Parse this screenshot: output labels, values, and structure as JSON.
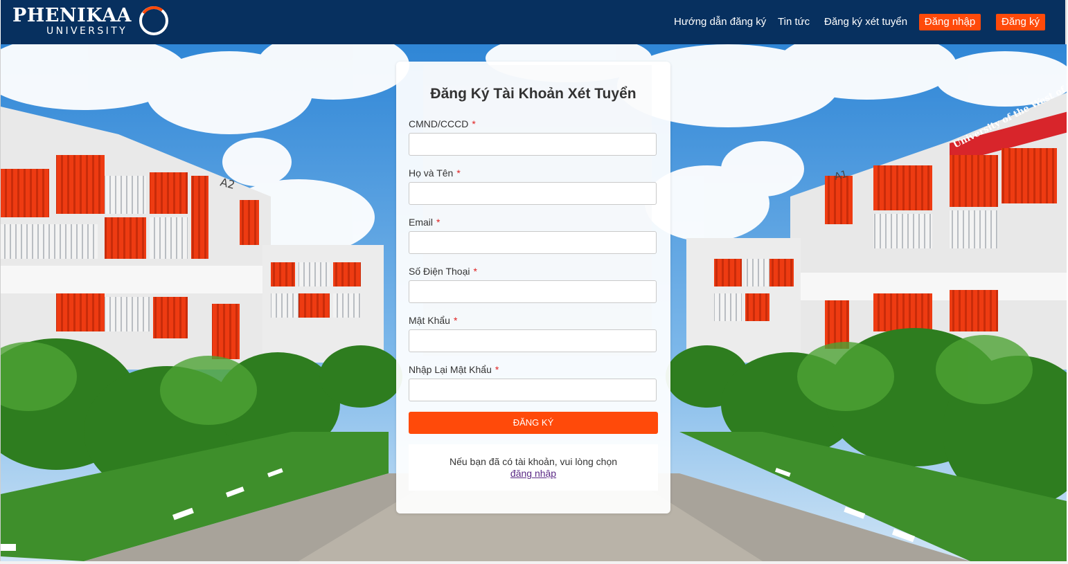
{
  "brand": {
    "name": "PHENIKAA",
    "sub": "UNIVERSITY",
    "color": "#07305f",
    "accent": "#ff4a0a"
  },
  "nav": {
    "guide": "Hướng dẫn đăng ký",
    "news": "Tin tức",
    "apply": "Đăng ký xét tuyển",
    "login": "Đăng nhập",
    "register": "Đăng ký"
  },
  "form": {
    "title": "Đăng Ký Tài Khoản Xét Tuyển",
    "required_mark": "*",
    "fields": [
      {
        "label": "CMND/CCCD",
        "value": ""
      },
      {
        "label": "Họ và Tên",
        "value": ""
      },
      {
        "label": "Email",
        "value": ""
      },
      {
        "label": "Số Điện Thoại",
        "value": ""
      },
      {
        "label": "Mật Khẩu",
        "value": ""
      },
      {
        "label": "Nhập Lại Mật Khẩu",
        "value": ""
      }
    ],
    "submit": "ĐĂNG KÝ",
    "login_prompt": "Nếu bạn đã có tài khoản, vui lòng chọn",
    "login_link": "đăng nhập"
  },
  "background": {
    "sign_text": "University of the West of En",
    "building_left": "A2",
    "building_right": "A1"
  }
}
